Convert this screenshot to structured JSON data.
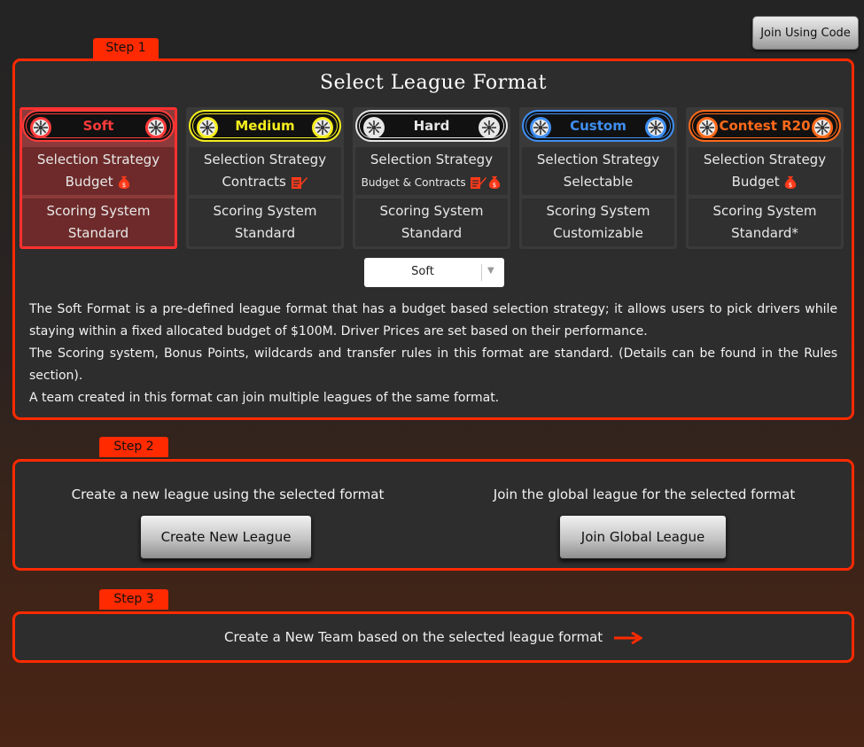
{
  "header": {
    "join_code_label": "Join Using Code"
  },
  "steps": {
    "step1": "Step 1",
    "step2": "Step 2",
    "step3": "Step 3"
  },
  "format": {
    "title": "Select League Format",
    "options": [
      {
        "name": "Soft",
        "color": "#ff3b3b",
        "strategy_label": "Selection Strategy",
        "strategy_value": "Budget",
        "strategy_icons": [
          "money-bag-icon"
        ],
        "scoring_label": "Scoring System",
        "scoring_value": "Standard",
        "selected": true
      },
      {
        "name": "Medium",
        "color": "#f5ee1e",
        "strategy_label": "Selection Strategy",
        "strategy_value": "Contracts",
        "strategy_icons": [
          "contract-icon"
        ],
        "scoring_label": "Scoring System",
        "scoring_value": "Standard",
        "selected": false
      },
      {
        "name": "Hard",
        "color": "#e6e6e6",
        "strategy_label": "Selection Strategy",
        "strategy_value": "Budget & Contracts",
        "strategy_icons": [
          "contract-icon",
          "money-bag-icon"
        ],
        "scoring_label": "Scoring System",
        "scoring_value": "Standard",
        "selected": false
      },
      {
        "name": "Custom",
        "color": "#3f8ff2",
        "strategy_label": "Selection Strategy",
        "strategy_value": "Selectable",
        "strategy_icons": [],
        "scoring_label": "Scoring System",
        "scoring_value": "Customizable",
        "selected": false
      },
      {
        "name": "Contest R20",
        "color": "#ff6a1a",
        "strategy_label": "Selection Strategy",
        "strategy_value": "Budget",
        "strategy_icons": [
          "money-bag-icon"
        ],
        "scoring_label": "Scoring System",
        "scoring_value": "Standard*",
        "selected": false
      }
    ],
    "dropdown_value": "Soft",
    "description": [
      "The Soft Format is a pre-defined league format that has a budget based selection strategy; it allows users to pick drivers while staying within a fixed allocated budget of $100M. Driver Prices are set based on their performance.",
      "The Scoring system, Bonus Points, wildcards and transfer rules in this format are standard. (Details can be found in the Rules section).",
      "A team created in this format can join multiple leagues of the same format."
    ]
  },
  "step2": {
    "create_caption": "Create a new league using the selected format",
    "create_button": "Create New League",
    "join_caption": "Join the global league for the selected format",
    "join_button": "Join Global League"
  },
  "step3": {
    "team_label": "Create a New Team based on the selected league format"
  },
  "colors": {
    "accent": "#ff2a00",
    "panel": "#2d2d2d"
  }
}
